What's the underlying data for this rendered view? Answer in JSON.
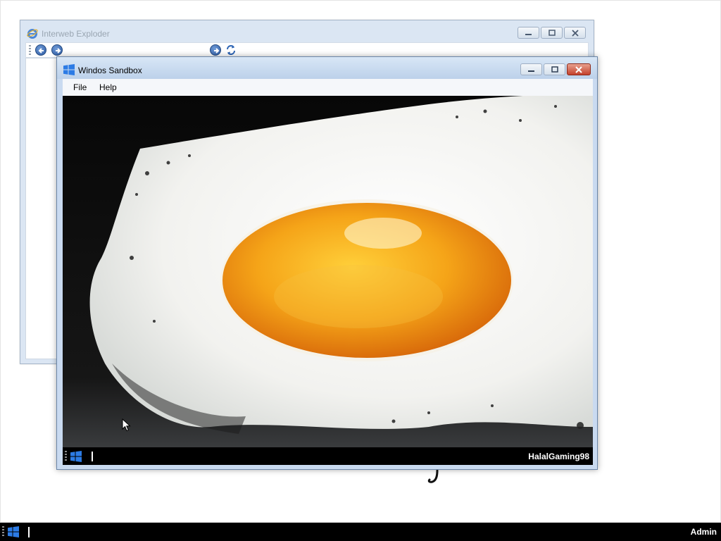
{
  "browser_window": {
    "title": "Interweb Exploder"
  },
  "sandbox_window": {
    "title": "Windos Sandbox",
    "menu": [
      "File",
      "Help"
    ],
    "screen_image": "fried-egg-in-pan",
    "taskbar": {
      "username": "HalalGaming98"
    }
  },
  "host_taskbar": {
    "username": "Admin"
  },
  "colors": {
    "accent": "#2c7be5",
    "taskbar": "#000000",
    "close_button": "#c4412c",
    "window_frame": "#c9daf0"
  }
}
